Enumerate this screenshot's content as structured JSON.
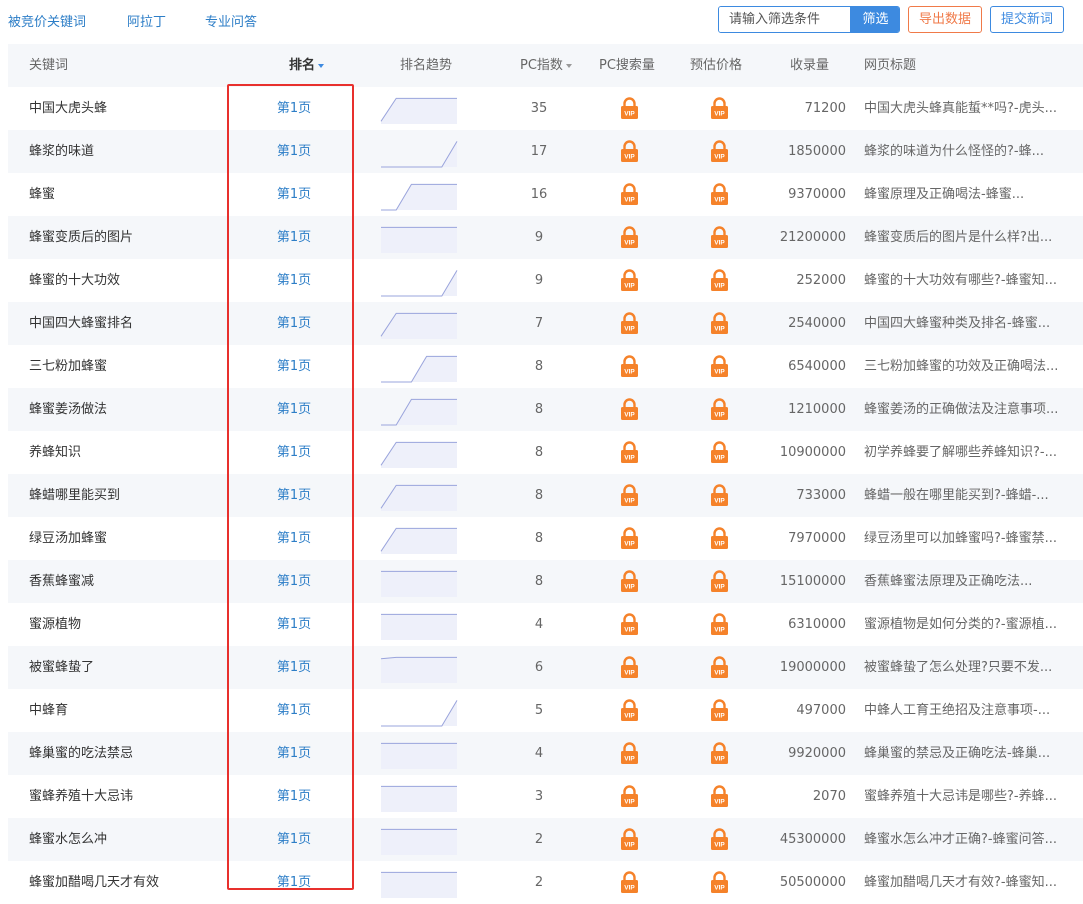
{
  "nav": {
    "competitor_keywords": "被竞价关键词",
    "alading": "阿拉丁",
    "pro_qa": "专业问答"
  },
  "filter": {
    "placeholder": "请输入筛选条件",
    "button": "筛选"
  },
  "actions": {
    "export": "导出数据",
    "submit": "提交新词"
  },
  "columns": {
    "keyword": "关键词",
    "rank": "排名",
    "trend": "排名趋势",
    "pc_index": "PC指数",
    "pc_search": "PC搜索量",
    "price": "预估价格",
    "indexed": "收录量",
    "page_title": "网页标题"
  },
  "colors": {
    "link": "#2d7ec7",
    "accent": "#3d8ae0",
    "export": "#f07a49",
    "vip": "#f5822a",
    "highlight_box": "#e8302d",
    "trend_line": "#9aa4dc",
    "trend_fill": "#eef0fa"
  },
  "vip_label": "VIP",
  "rows": [
    {
      "keyword": "中国大虎头蜂",
      "rank": "第1页",
      "trend": [
        0.1,
        0.95,
        0.95,
        0.95,
        0.95,
        0.95
      ],
      "pc_index": "35",
      "indexed": "71200",
      "title": "中国大虎头蜂真能蜇**吗?-虎头..."
    },
    {
      "keyword": "蜂浆的味道",
      "rank": "第1页",
      "trend": [
        0,
        0,
        0,
        0,
        0,
        0.95
      ],
      "pc_index": "17",
      "indexed": "1850000",
      "title": "蜂浆的味道为什么怪怪的?-蜂..."
    },
    {
      "keyword": "蜂蜜",
      "rank": "第1页",
      "trend": [
        0,
        0,
        0.95,
        0.95,
        0.95,
        0.95
      ],
      "pc_index": "16",
      "indexed": "9370000",
      "title": "蜂蜜原理及正确喝法-蜂蜜..."
    },
    {
      "keyword": "蜂蜜变质后的图片",
      "rank": "第1页",
      "trend": [
        0.95,
        0.95,
        0.95,
        0.95,
        0.95,
        0.95
      ],
      "pc_index": "9",
      "indexed": "21200000",
      "title": "蜂蜜变质后的图片是什么样?出..."
    },
    {
      "keyword": "蜂蜜的十大功效",
      "rank": "第1页",
      "trend": [
        0,
        0,
        0,
        0,
        0,
        0.95
      ],
      "pc_index": "9",
      "indexed": "252000",
      "title": "蜂蜜的十大功效有哪些?-蜂蜜知..."
    },
    {
      "keyword": "中国四大蜂蜜排名",
      "rank": "第1页",
      "trend": [
        0.1,
        0.95,
        0.95,
        0.95,
        0.95,
        0.95
      ],
      "pc_index": "7",
      "indexed": "2540000",
      "title": "中国四大蜂蜜种类及排名-蜂蜜..."
    },
    {
      "keyword": "三七粉加蜂蜜",
      "rank": "第1页",
      "trend": [
        0,
        0,
        0,
        0.95,
        0.95,
        0.95
      ],
      "pc_index": "8",
      "indexed": "6540000",
      "title": "三七粉加蜂蜜的功效及正确喝法..."
    },
    {
      "keyword": "蜂蜜姜汤做法",
      "rank": "第1页",
      "trend": [
        0,
        0,
        0.95,
        0.95,
        0.95,
        0.95
      ],
      "pc_index": "8",
      "indexed": "1210000",
      "title": "蜂蜜姜汤的正确做法及注意事项..."
    },
    {
      "keyword": "养蜂知识",
      "rank": "第1页",
      "trend": [
        0.1,
        0.95,
        0.95,
        0.95,
        0.95,
        0.95
      ],
      "pc_index": "8",
      "indexed": "10900000",
      "title": "初学养蜂要了解哪些养蜂知识?-..."
    },
    {
      "keyword": "蜂蜡哪里能买到",
      "rank": "第1页",
      "trend": [
        0.1,
        0.95,
        0.95,
        0.95,
        0.95,
        0.95
      ],
      "pc_index": "8",
      "indexed": "733000",
      "title": "蜂蜡一般在哪里能买到?-蜂蜡-..."
    },
    {
      "keyword": "绿豆汤加蜂蜜",
      "rank": "第1页",
      "trend": [
        0.1,
        0.95,
        0.95,
        0.95,
        0.95,
        0.95
      ],
      "pc_index": "8",
      "indexed": "7970000",
      "title": "绿豆汤里可以加蜂蜜吗?-蜂蜜禁..."
    },
    {
      "keyword": "香蕉蜂蜜减",
      "rank": "第1页",
      "trend": [
        0.95,
        0.95,
        0.95,
        0.95,
        0.95,
        0.95
      ],
      "pc_index": "8",
      "indexed": "15100000",
      "title": "香蕉蜂蜜法原理及正确吃法..."
    },
    {
      "keyword": "蜜源植物",
      "rank": "第1页",
      "trend": [
        0.95,
        0.95,
        0.95,
        0.95,
        0.95,
        0.95
      ],
      "pc_index": "4",
      "indexed": "6310000",
      "title": "蜜源植物是如何分类的?-蜜源植..."
    },
    {
      "keyword": "被蜜蜂蛰了",
      "rank": "第1页",
      "trend": [
        0.9,
        0.95,
        0.95,
        0.95,
        0.95,
        0.95
      ],
      "pc_index": "6",
      "indexed": "19000000",
      "title": "被蜜蜂蛰了怎么处理?只要不发..."
    },
    {
      "keyword": "中蜂育",
      "rank": "第1页",
      "trend": [
        0,
        0,
        0,
        0,
        0,
        0.95
      ],
      "pc_index": "5",
      "indexed": "497000",
      "title": "中蜂人工育王绝招及注意事项-..."
    },
    {
      "keyword": "蜂巢蜜的吃法禁忌",
      "rank": "第1页",
      "trend": [
        0.95,
        0.95,
        0.95,
        0.95,
        0.95,
        0.95
      ],
      "pc_index": "4",
      "indexed": "9920000",
      "title": "蜂巢蜜的禁忌及正确吃法-蜂巢..."
    },
    {
      "keyword": "蜜蜂养殖十大忌讳",
      "rank": "第1页",
      "trend": [
        0.95,
        0.95,
        0.95,
        0.95,
        0.95,
        0.95
      ],
      "pc_index": "3",
      "indexed": "2070",
      "title": "蜜蜂养殖十大忌讳是哪些?-养蜂..."
    },
    {
      "keyword": "蜂蜜水怎么冲",
      "rank": "第1页",
      "trend": [
        0.95,
        0.95,
        0.95,
        0.95,
        0.95,
        0.95
      ],
      "pc_index": "2",
      "indexed": "45300000",
      "title": "蜂蜜水怎么冲才正确?-蜂蜜问答..."
    },
    {
      "keyword": "蜂蜜加醋喝几天才有效",
      "rank": "第1页",
      "trend": [
        0.95,
        0.95,
        0.95,
        0.95,
        0.95,
        0.95
      ],
      "pc_index": "2",
      "indexed": "50500000",
      "title": "蜂蜜加醋喝几天才有效?-蜂蜜知..."
    }
  ]
}
